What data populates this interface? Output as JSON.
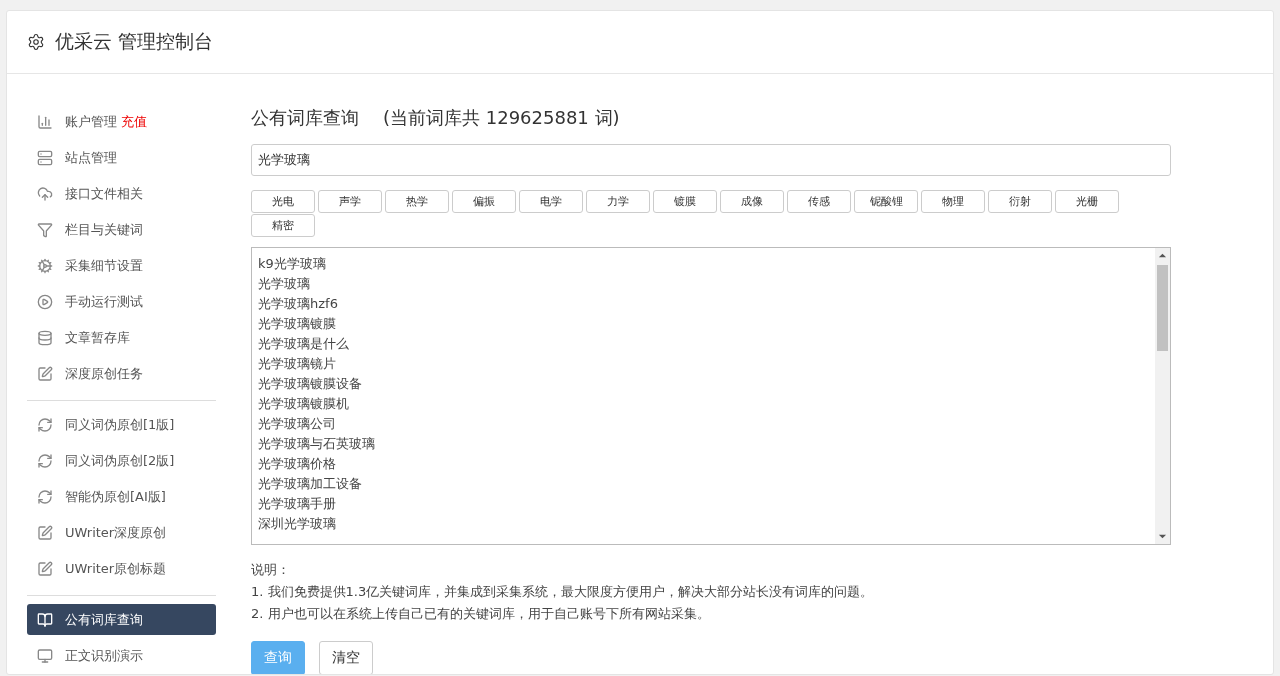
{
  "header": {
    "title": "优采云 管理控制台"
  },
  "sidebar": {
    "groups": [
      {
        "items": [
          {
            "label": "账户管理",
            "badge": "充值",
            "selected": false
          },
          {
            "label": "站点管理",
            "selected": false
          },
          {
            "label": "接口文件相关",
            "selected": false
          },
          {
            "label": "栏目与关键词",
            "selected": false
          },
          {
            "label": "采集细节设置",
            "selected": false
          },
          {
            "label": "手动运行测试",
            "selected": false
          },
          {
            "label": "文章暂存库",
            "selected": false
          },
          {
            "label": "深度原创任务",
            "selected": false
          }
        ]
      },
      {
        "items": [
          {
            "label": "同义词伪原创[1版]",
            "selected": false
          },
          {
            "label": "同义词伪原创[2版]",
            "selected": false
          },
          {
            "label": "智能伪原创[AI版]",
            "selected": false
          },
          {
            "label": "UWriter深度原创",
            "selected": false
          },
          {
            "label": "UWriter原创标题",
            "selected": false
          }
        ]
      },
      {
        "items": [
          {
            "label": "公有词库查询",
            "selected": true
          },
          {
            "label": "正文识别演示",
            "selected": false
          }
        ]
      }
    ]
  },
  "main": {
    "title": "公有词库查询",
    "count": "(当前词库共 129625881 词)",
    "search": {
      "value": "光学玻璃"
    },
    "tags": [
      "光电",
      "声学",
      "热学",
      "偏振",
      "电学",
      "力学",
      "镀膜",
      "成像",
      "传感",
      "铌酸锂",
      "物理",
      "衍射",
      "光栅",
      "精密"
    ],
    "results": [
      "k9光学玻璃",
      "光学玻璃",
      "光学玻璃hzf6",
      "光学玻璃镀膜",
      "光学玻璃是什么",
      "光学玻璃镜片",
      "光学玻璃镀膜设备",
      "光学玻璃镀膜机",
      "光学玻璃公司",
      "光学玻璃与石英玻璃",
      "光学玻璃价格",
      "光学玻璃加工设备",
      "光学玻璃手册",
      "深圳光学玻璃"
    ],
    "notes_title": "说明：",
    "notes": [
      "1. 我们免费提供1.3亿关键词库，并集成到采集系统，最大限度方便用户，解决大部分站长没有词库的问题。",
      "2. 用户也可以在系统上传自己已有的关键词库，用于自己账号下所有网站采集。"
    ],
    "buttons": [
      {
        "label": "查询",
        "kind": "primary"
      },
      {
        "label": "清空",
        "kind": "default"
      }
    ]
  }
}
